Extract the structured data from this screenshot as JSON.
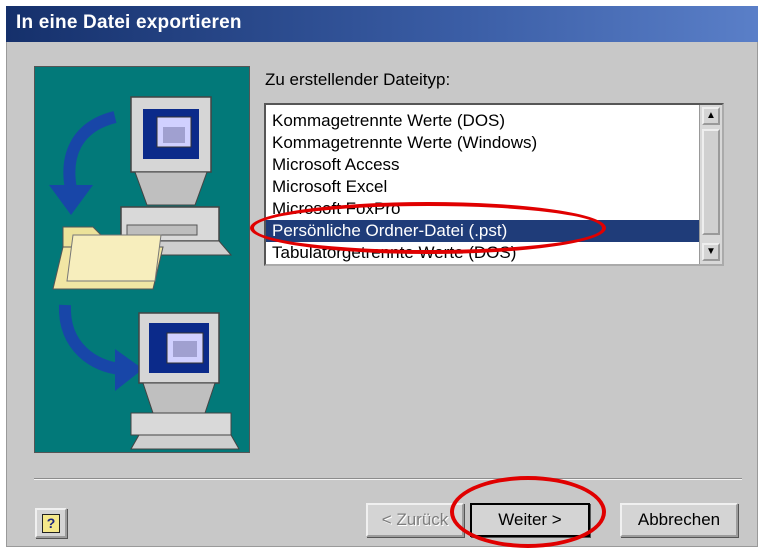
{
  "window": {
    "title": "In eine Datei exportieren"
  },
  "list": {
    "label": "Zu erstellender Dateityp:",
    "label_accesskey": "u",
    "items": [
      "Kommagetrennte Werte (DOS)",
      "Kommagetrennte Werte (Windows)",
      "Microsoft Access",
      "Microsoft Excel",
      "Microsoft FoxPro",
      "Persönliche Ordner-Datei (.pst)",
      "Tabulatorgetrennte Werte (DOS)"
    ],
    "selected_index": 5
  },
  "buttons": {
    "help": "?",
    "back": "< Zurück",
    "next": "Weiter >",
    "cancel": "Abbrechen"
  },
  "colors": {
    "title_bar": "#15306b",
    "illustration_bg": "#027979",
    "selection": "#1f3c79",
    "highlight_ring": "#e00000"
  }
}
